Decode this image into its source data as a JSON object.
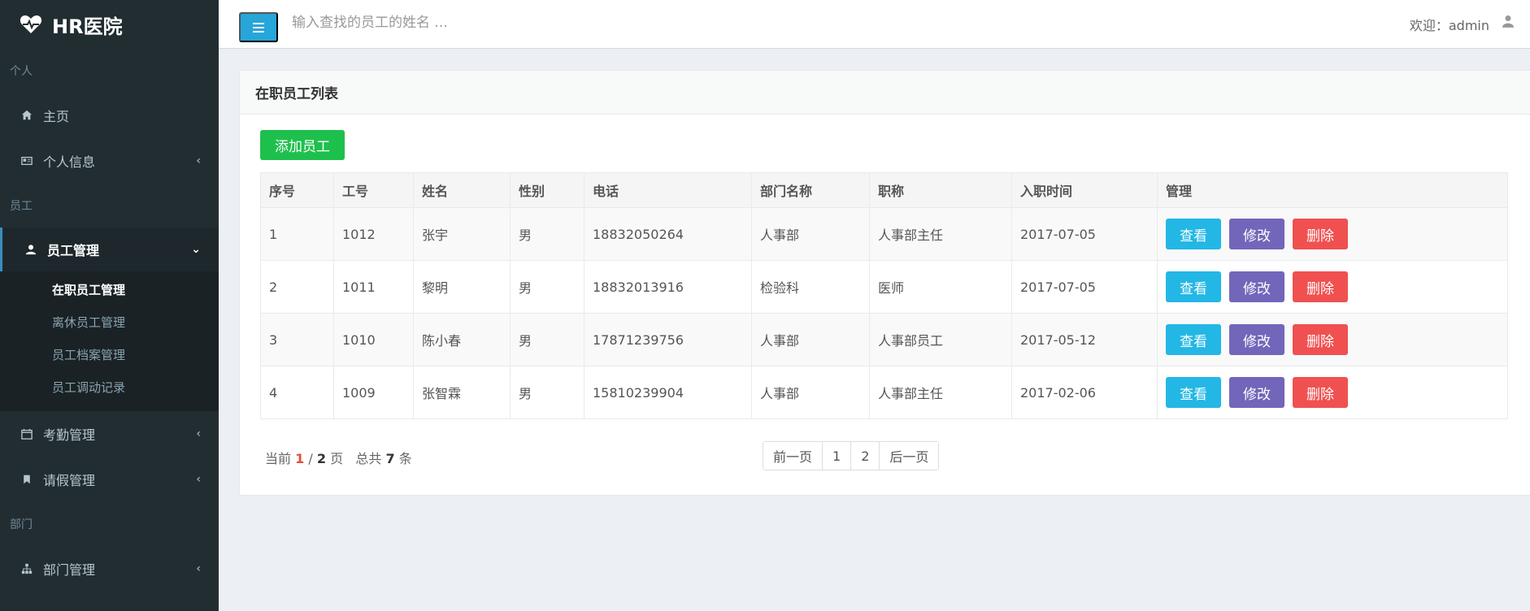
{
  "app": {
    "title": "HR医院"
  },
  "sidebar": {
    "sections": {
      "personal": "个人",
      "employee": "员工",
      "department": "部门"
    },
    "items": {
      "home": "主页",
      "personal_info": "个人信息",
      "employee_mgmt": "员工管理",
      "attendance": "考勤管理",
      "leave": "请假管理",
      "dept_mgmt": "部门管理"
    },
    "submenu": [
      "在职员工管理",
      "离休员工管理",
      "员工档案管理",
      "员工调动记录"
    ]
  },
  "header": {
    "search_placeholder": "输入查找的员工的姓名 ...",
    "welcome": "欢迎：admin"
  },
  "main": {
    "box_title": "在职员工列表",
    "add_button": "添加员工",
    "table": {
      "columns": [
        "序号",
        "工号",
        "姓名",
        "性别",
        "电话",
        "部门名称",
        "职称",
        "入职时间",
        "管理"
      ],
      "rows": [
        [
          "1",
          "1012",
          "张宇",
          "男",
          "18832050264",
          "人事部",
          "人事部主任",
          "2017-07-05"
        ],
        [
          "2",
          "1011",
          "黎明",
          "男",
          "18832013916",
          "检验科",
          "医师",
          "2017-07-05"
        ],
        [
          "3",
          "1010",
          "陈小春",
          "男",
          "17871239756",
          "人事部",
          "人事部员工",
          "2017-05-12"
        ],
        [
          "4",
          "1009",
          "张智霖",
          "男",
          "15810239904",
          "人事部",
          "人事部主任",
          "2017-02-06"
        ]
      ],
      "actions": {
        "view": "查看",
        "edit": "修改",
        "delete": "删除"
      }
    },
    "pagination": {
      "current_prefix": "当前",
      "current_page": "1",
      "sep": "/",
      "total_pages": "2",
      "page_unit": "页",
      "total_prefix": "总共",
      "total_count": "7",
      "count_unit": "条",
      "prev": "前一页",
      "pages": [
        "1",
        "2"
      ],
      "next": "后一页"
    }
  },
  "colors": {
    "sidebar_bg": "#222d32",
    "menu_button": "#26a6d9",
    "add_button": "#1ec04d",
    "view": "#23b7e5",
    "edit": "#7266ba",
    "delete": "#f05050"
  }
}
